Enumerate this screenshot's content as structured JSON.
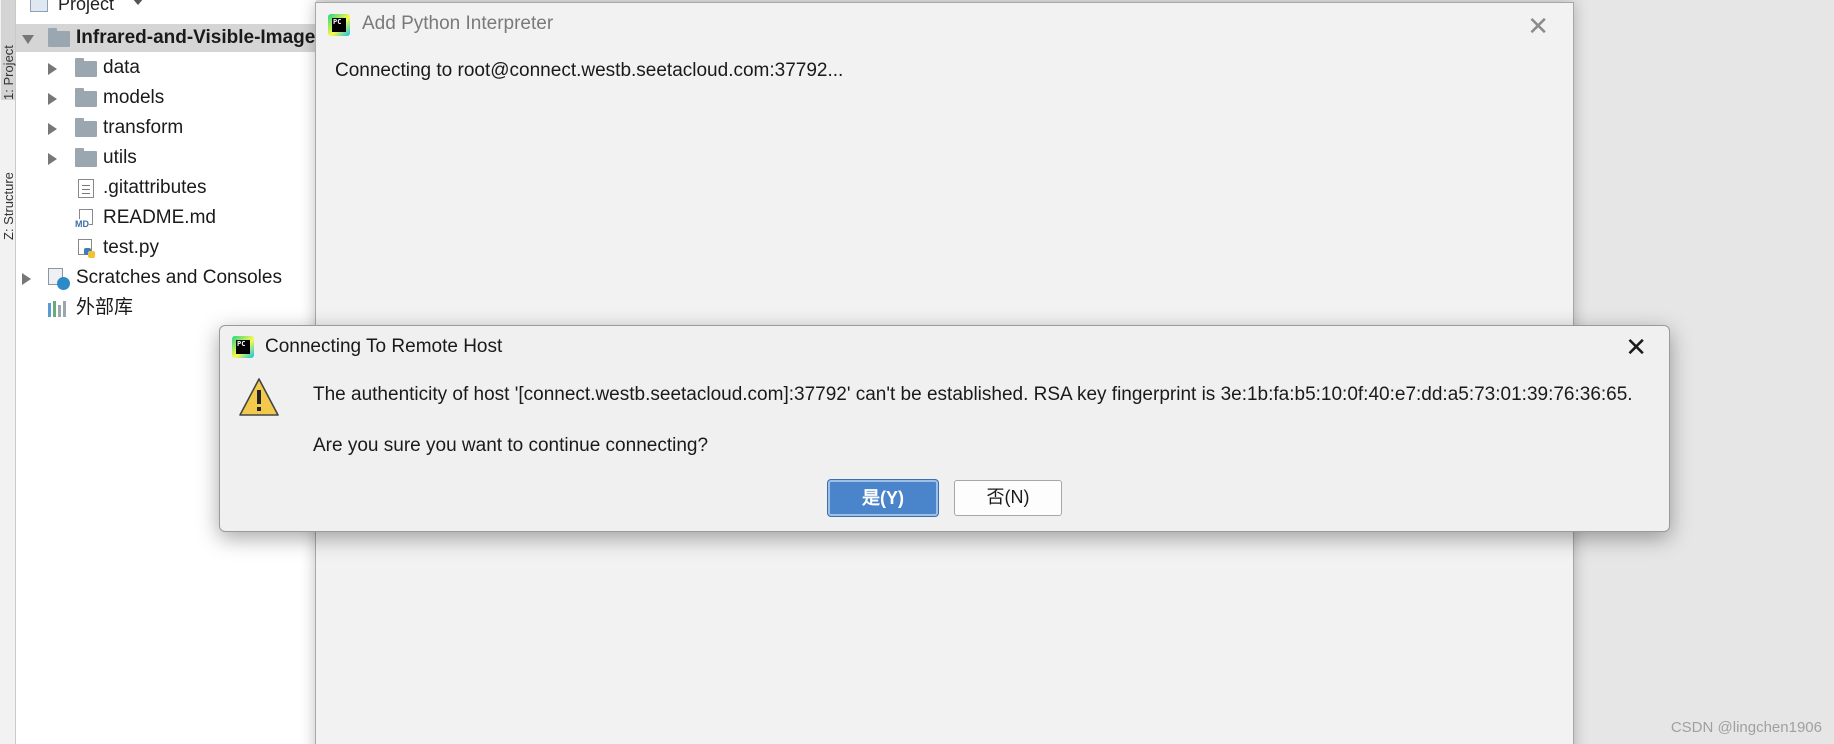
{
  "sidebar": {
    "tab_project": "1: Project",
    "tab_structure": "Z: Structure"
  },
  "project_panel": {
    "header_label": "Project",
    "root": "Infrared-and-Visible-Image",
    "items": [
      {
        "label": "data"
      },
      {
        "label": "models"
      },
      {
        "label": "transform"
      },
      {
        "label": "utils"
      },
      {
        "label": ".gitattributes"
      },
      {
        "label": "README.md"
      },
      {
        "label": "test.py"
      }
    ],
    "scratches": "Scratches and Consoles",
    "external_libs": "外部库",
    "md_tag": "MD"
  },
  "interpreter_dialog": {
    "title": "Add Python Interpreter",
    "status": "Connecting to root@connect.westb.seetacloud.com:37792...",
    "logo_text": "PC"
  },
  "host_dialog": {
    "title": "Connecting To Remote Host",
    "message": "The authenticity of host '[connect.westb.seetacloud.com]:37792' can't be established. RSA key fingerprint is 3e:1b:fa:b5:10:0f:40:e7:dd:a5:73:01:39:76:36:65.",
    "question": "Are you sure you want to continue connecting?",
    "yes_label": "是(Y)",
    "no_label": "否(N)",
    "logo_text": "PC"
  },
  "watermark": "CSDN @lingchen1906",
  "colors": {
    "primary_button": "#4a84cb",
    "folder": "#9aa7b0",
    "warning": "#f2c94c"
  }
}
